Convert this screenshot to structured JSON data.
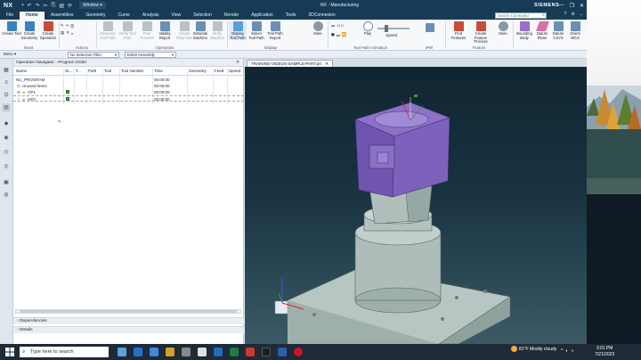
{
  "titlebar": {
    "logo": "NX",
    "window_menu": "Window ▾",
    "app_title": "NX - Manufacturing",
    "brand": "SIEMENS",
    "controls": [
      "—",
      "❐",
      "✕"
    ]
  },
  "tabs": [
    "File",
    "Home",
    "Assemblies",
    "Geometry",
    "Curve",
    "Analysis",
    "View",
    "Selection",
    "Render",
    "Application",
    "Tools",
    "3DConnexion"
  ],
  "active_tab": "Home",
  "search_placeholder": "Search Command",
  "ribbon": {
    "buttons": [
      {
        "label": "Create Tool",
        "color": "#3d7fbf"
      },
      {
        "label": "Create Geometry",
        "color": "#3d7fbf"
      },
      {
        "label": "Create Operation",
        "color": "#c84b3a"
      },
      {
        "label": "Generate Tool Path",
        "color": "#b9c2c9"
      },
      {
        "label": "Verify Tool Path",
        "color": "#b9c2c9"
      },
      {
        "label": "Post Process",
        "color": "#b9c2c9"
      },
      {
        "label": "Validity Report",
        "color": "#6a8fb5"
      },
      {
        "label": "Create Shop Doc",
        "color": "#b9c2c9"
      },
      {
        "label": "Simulate Machine",
        "color": "#6a8fb5"
      },
      {
        "label": "Verify Machine",
        "color": "#b9c2c9"
      },
      {
        "label": "More",
        "color": "#8a98a6"
      },
      {
        "label": "Display Tool Path",
        "color": "#5aa0d8"
      },
      {
        "label": "Select Tool Path",
        "color": "#6a8fb5"
      },
      {
        "label": "Tool Path Report",
        "color": "#6a8fb5"
      },
      {
        "label": "More",
        "color": "#8a98a6"
      },
      {
        "label": "Play",
        "color": "#6a8fb5"
      },
      {
        "label": "Find Features",
        "color": "#c84b3a"
      },
      {
        "label": "Create Feature Process",
        "color": "#c84b3a"
      },
      {
        "label": "More",
        "color": "#8a98a6"
      },
      {
        "label": "Bounding Body",
        "color": "#9b6fc9"
      },
      {
        "label": "Datum Plane",
        "color": "#d86fa4"
      },
      {
        "label": "Datum CSYS",
        "color": "#6a8fb5"
      },
      {
        "label": "Orient WCS",
        "color": "#6a8fb5"
      }
    ],
    "groups": [
      "Insert",
      "Actions",
      "Operations",
      "Display",
      "Tool Path Animation",
      "Feature"
    ],
    "speed_label": "Speed",
    "ipw_label": "IPW"
  },
  "selbar": {
    "menu_label": "Menu ▾",
    "filter": "No Selection Filter",
    "scope": "Entire Assembly"
  },
  "navigator": {
    "title": "Operation Navigator - Program Order",
    "columns": [
      "Name",
      "St...",
      "T...",
      "Path",
      "Tool",
      "Tool Number",
      "Time",
      "Geometry",
      "Feed",
      "Speed"
    ],
    "rows": [
      {
        "name": "NC_PROGRAM",
        "time": "00:00:00",
        "indent": 0
      },
      {
        "name": "Unused Items",
        "time": "00:00:00",
        "indent": 1
      },
      {
        "name": "OP1",
        "time": "00:00:00",
        "indent": 1
      },
      {
        "name": "OP2",
        "time": "00:00:00",
        "indent": 1
      }
    ],
    "panels": [
      "Dependencies",
      "Details"
    ]
  },
  "viewport": {
    "tab": "TRAINING-VIDEOS-SAMPLE-PART.prt",
    "tab_close": "✕"
  },
  "taskbar": {
    "search_placeholder": "Type here to search",
    "weather": "81°F  Mostly cloudy",
    "time": "3:01 PM",
    "date": "7/21/2023"
  }
}
